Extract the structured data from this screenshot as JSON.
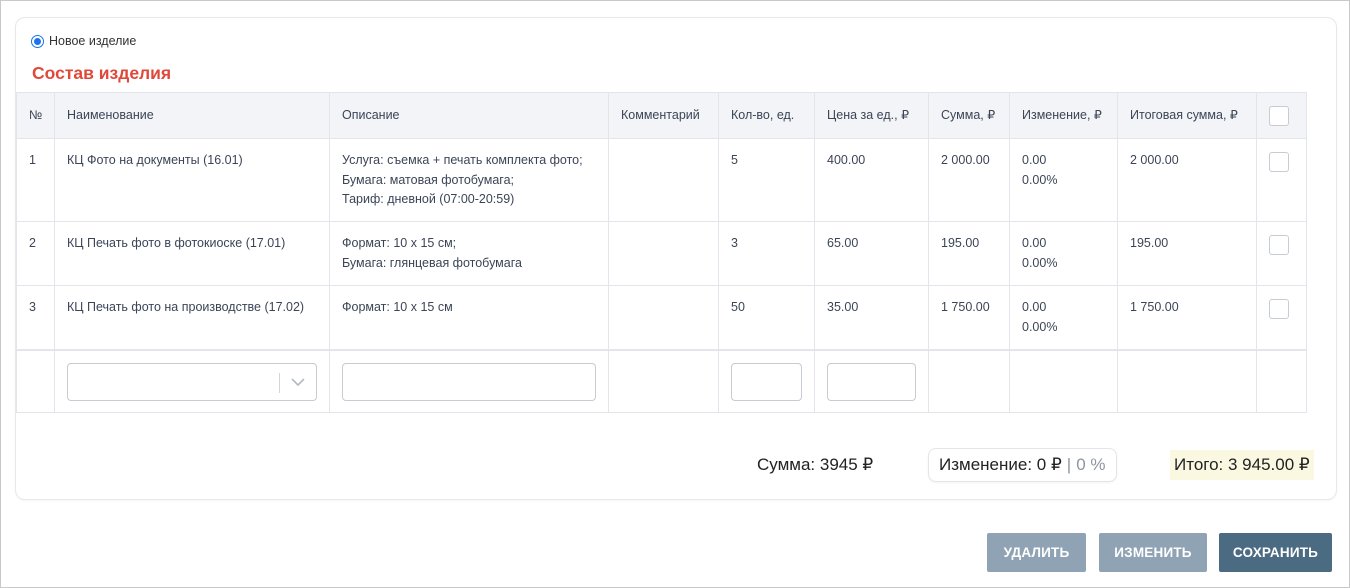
{
  "radio": {
    "label": "Новое изделие",
    "selected": true
  },
  "section_title": "Состав изделия",
  "table": {
    "headers": [
      "№",
      "Наименование",
      "Описание",
      "Комментарий",
      "Кол-во, ед.",
      "Цена за ед., ₽",
      "Сумма, ₽",
      "Изменение, ₽",
      "Итоговая сумма, ₽"
    ],
    "rows": [
      {
        "num": "1",
        "name": "КЦ Фото на документы (16.01)",
        "desc": [
          "Услуга: съемка + печать комплекта фото;",
          "Бумага: матовая фотобумага;",
          "Тариф: дневной (07:00-20:59)"
        ],
        "comment": "",
        "qty": "5",
        "price": "400.00",
        "sum": "2 000.00",
        "change": "0.00",
        "change_pct": "0.00%",
        "total": "2 000.00",
        "checked": false
      },
      {
        "num": "2",
        "name": "КЦ Печать фото в фотокиоске (17.01)",
        "desc": [
          "Формат: 10 х 15 см;",
          "Бумага: глянцевая фотобумага"
        ],
        "comment": "",
        "qty": "3",
        "price": "65.00",
        "sum": "195.00",
        "change": "0.00",
        "change_pct": "0.00%",
        "total": "195.00",
        "checked": false
      },
      {
        "num": "3",
        "name": "КЦ Печать фото на производстве (17.02)",
        "desc": [
          "Формат: 10 х 15 см"
        ],
        "comment": "",
        "qty": "50",
        "price": "35.00",
        "sum": "1 750.00",
        "change": "0.00",
        "change_pct": "0.00%",
        "total": "1 750.00",
        "checked": false
      }
    ],
    "new_row": {
      "name_value": "",
      "desc_value": "",
      "qty_value": "",
      "price_value": ""
    }
  },
  "totals": {
    "sum_label": "Сумма: 3945 ₽",
    "change_label": "Изменение: 0 ₽",
    "change_sep": "|",
    "change_pct": "0 %",
    "total_label": "Итого: 3 945.00 ₽"
  },
  "buttons": {
    "delete": "УДАЛИТЬ",
    "edit": "ИЗМЕНИТЬ",
    "save": "СОХРАНИТЬ"
  },
  "colors": {
    "accent_title": "#e0493a",
    "radio_blue": "#1a73e8",
    "button_muted": "#8fa3b4",
    "button_primary": "#4b6b82",
    "total_highlight": "#fbf8e2"
  }
}
